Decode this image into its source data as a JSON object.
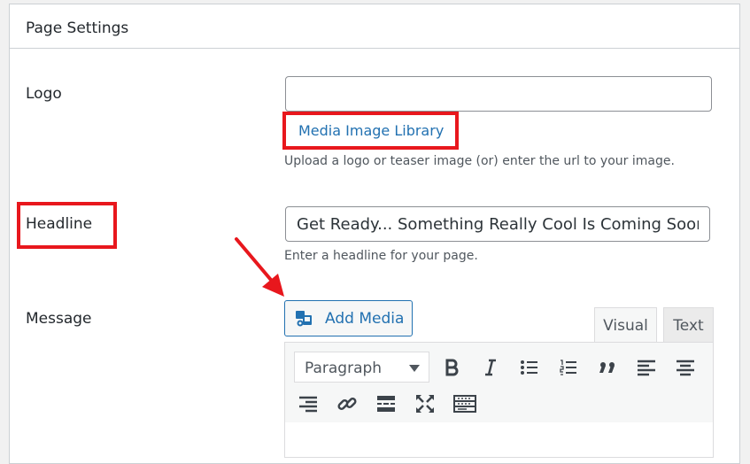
{
  "panel": {
    "title": "Page Settings"
  },
  "logo": {
    "label": "Logo",
    "value": "",
    "media_link": "Media Image Library",
    "help": "Upload a logo or teaser image (or) enter the url to your image."
  },
  "headline": {
    "label": "Headline",
    "value": "Get Ready... Something Really Cool Is Coming Soon",
    "help": "Enter a headline for your page."
  },
  "message": {
    "label": "Message",
    "add_media_label": "Add Media",
    "tabs": {
      "visual": "Visual",
      "text": "Text"
    },
    "format_select": "Paragraph",
    "toolbar_icons": [
      "bold-icon",
      "italic-icon",
      "bullet-list-icon",
      "numbered-list-icon",
      "blockquote-icon",
      "align-left-icon",
      "align-center-icon",
      "align-right-icon",
      "link-icon",
      "read-more-icon",
      "fullscreen-icon",
      "toolbar-toggle-icon"
    ]
  },
  "colors": {
    "highlight": "#e8171d",
    "link": "#2271b1",
    "text": "#23282d"
  }
}
